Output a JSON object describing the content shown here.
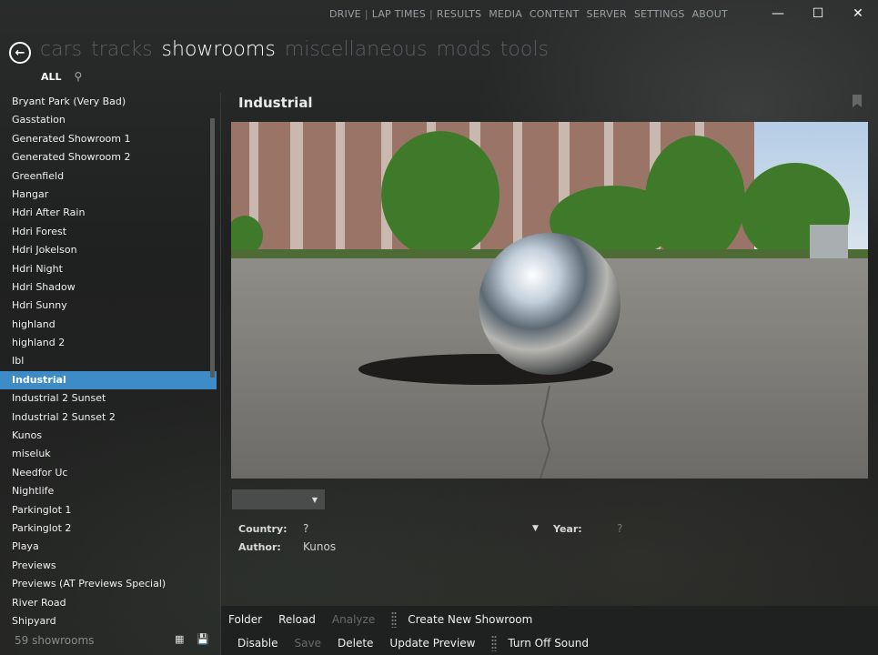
{
  "top_menu": [
    "DRIVE",
    "LAP TIMES",
    "RESULTS",
    "MEDIA",
    "CONTENT",
    "SERVER",
    "SETTINGS",
    "ABOUT"
  ],
  "window_controls": {
    "minimize": "—",
    "maximize": "☐",
    "close": "✕"
  },
  "main_nav": {
    "back_icon": "arrow-left-icon",
    "items": [
      "cars",
      "tracks",
      "showrooms",
      "miscellaneous",
      "mods",
      "tools"
    ],
    "active": "showrooms"
  },
  "sub_nav": {
    "all": "ALL",
    "search_icon": "⌕"
  },
  "showrooms": [
    "Bryant Park (Very Bad)",
    "Gasstation",
    "Generated Showroom 1",
    "Generated Showroom 2",
    "Greenfield",
    "Hangar",
    "Hdri After Rain",
    "Hdri Forest",
    "Hdri Jokelson",
    "Hdri Night",
    "Hdri Shadow",
    "Hdri Sunny",
    "highland",
    "highland 2",
    "Ibl",
    "Industrial",
    "Industrial 2 Sunset",
    "Industrial 2 Sunset 2",
    "Kunos",
    "miseluk",
    "Needfor Uc",
    "Nightlife",
    "Parkinglot 1",
    "Parkinglot 2",
    "Playa",
    "Previews",
    "Previews (AT Previews Special)",
    "River Road",
    "Shipyard"
  ],
  "selected": "Industrial",
  "count_label": "59 showrooms",
  "detail": {
    "title": "Industrial",
    "country_label": "Country:",
    "country_value": "?",
    "year_label": "Year:",
    "year_value": "?",
    "author_label": "Author:",
    "author_value": "Kunos"
  },
  "toolbar": {
    "row1": [
      "Folder",
      "Reload",
      "Analyze",
      "Create New Showroom"
    ],
    "row2": [
      "Disable",
      "Save",
      "Delete",
      "Update Preview",
      "Turn Off Sound"
    ]
  }
}
